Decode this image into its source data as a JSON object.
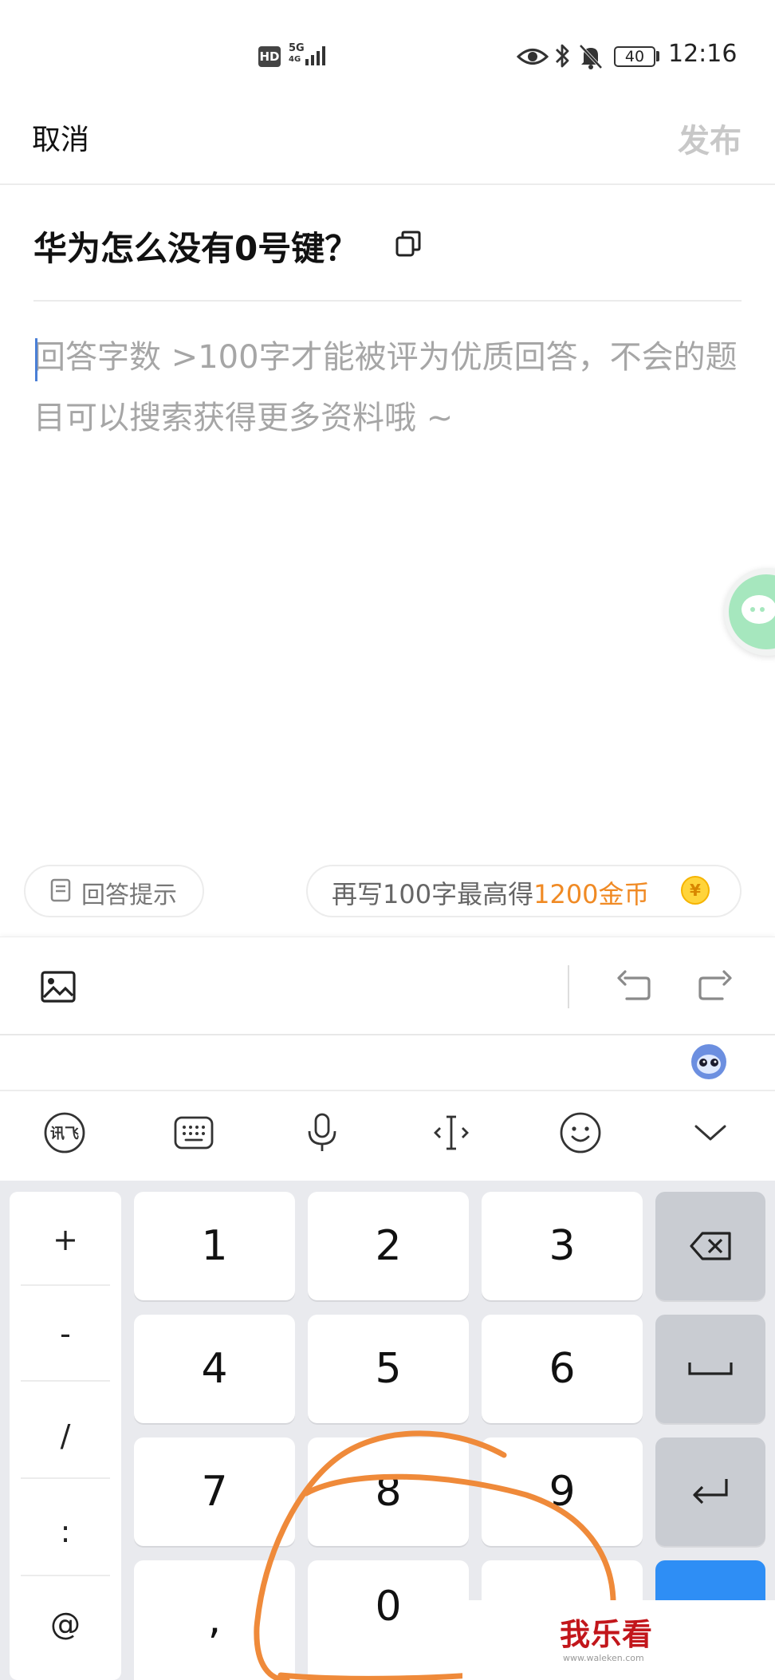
{
  "status_bar": {
    "hd": "HD",
    "network_top": "5G",
    "network_bottom": "4G",
    "battery": "40",
    "time": "12:16"
  },
  "header": {
    "cancel_label": "取消",
    "publish_label": "发布"
  },
  "question": {
    "title": "华为怎么没有0号键？"
  },
  "answer": {
    "placeholder": "回答字数 >100字才能被评为优质回答，不会的题目可以搜索获得更多资料哦 ~"
  },
  "hints": {
    "tips_label": "回答提示",
    "reward_prefix": "再写100字最高得",
    "reward_highlight": "1200金币",
    "coin_glyph": "¥"
  },
  "keyboard": {
    "side_keys": [
      "+",
      "-",
      "/",
      ":",
      "@"
    ],
    "number_keys": [
      "1",
      "2",
      "3",
      "4",
      "5",
      "6",
      "7",
      "8",
      "9",
      ",",
      "0"
    ],
    "accent_color": "#2e8ef5"
  },
  "watermark": {
    "text": "我乐看",
    "url": "www.waleken.com"
  },
  "colors": {
    "reward_highlight": "#f08a24",
    "doodle": "#ef8a3a",
    "caret": "#4a7fd6"
  }
}
